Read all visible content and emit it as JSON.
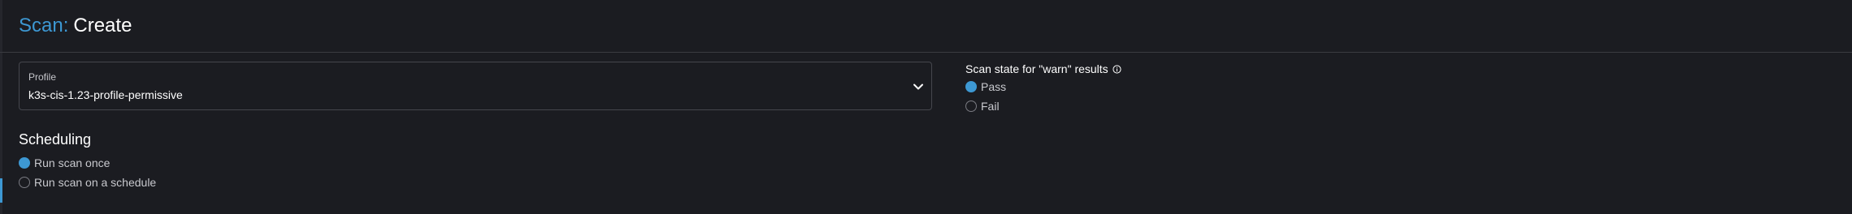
{
  "header": {
    "breadcrumb": "Scan",
    "separator": ":",
    "title": "Create"
  },
  "profile": {
    "label": "Profile",
    "value": "k3s-cis-1.23-profile-permissive",
    "icon": "chevron-down-icon"
  },
  "warn_state": {
    "title": "Scan state for \"warn\" results",
    "info_icon": "info-icon",
    "options": [
      {
        "label": "Pass",
        "selected": true
      },
      {
        "label": "Fail",
        "selected": false
      }
    ]
  },
  "scheduling": {
    "title": "Scheduling",
    "options": [
      {
        "label": "Run scan once",
        "selected": true
      },
      {
        "label": "Run scan on a schedule",
        "selected": false
      }
    ]
  },
  "colors": {
    "background": "#1b1c21",
    "accent": "#3d98d3",
    "border": "#45464d"
  }
}
